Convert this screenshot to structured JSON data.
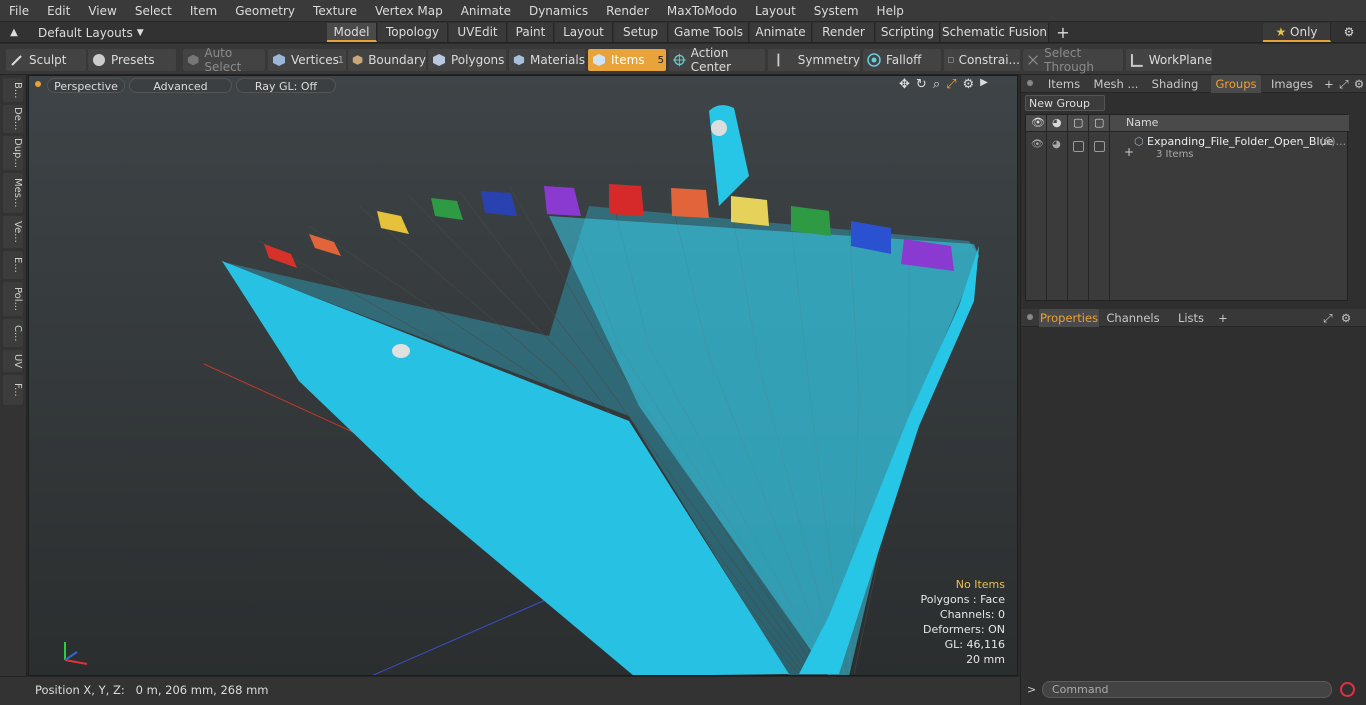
{
  "menu": [
    "File",
    "Edit",
    "View",
    "Select",
    "Item",
    "Geometry",
    "Texture",
    "Vertex Map",
    "Animate",
    "Dynamics",
    "Render",
    "MaxToModo",
    "Layout",
    "System",
    "Help"
  ],
  "layout_dropdown": "Default Layouts",
  "tabs": [
    "Model",
    "Topology",
    "UVEdit",
    "Paint",
    "Layout",
    "Setup",
    "Game Tools",
    "Animate",
    "Render",
    "Scripting",
    "Schematic Fusion"
  ],
  "only_label": "Only",
  "toolbar": {
    "sculpt": "Sculpt",
    "presets": "Presets",
    "auto_select": "Auto Select",
    "vertices": "Vertices",
    "vertices_count": "1",
    "boundary": "Boundary",
    "polygons": "Polygons",
    "materials": "Materials",
    "items": "Items",
    "items_count": "5",
    "action_center": "Action Center",
    "symmetry": "Symmetry",
    "falloff": "Falloff",
    "constraints": "Constrai...",
    "select_through": "Select Through",
    "workplane": "WorkPlane"
  },
  "left_tabs": [
    "B...",
    "De...",
    "Dup...",
    "Mes...",
    "Ve...",
    "E...",
    "Pol...",
    "C...",
    "UV",
    "F..."
  ],
  "viewport": {
    "perspective": "Perspective",
    "advanced": "Advanced",
    "raygl": "Ray GL: Off",
    "info": {
      "no_items": "No Items",
      "polygons": "Polygons : Face",
      "channels": "Channels: 0",
      "deformers": "Deformers: ON",
      "gl": "GL: 46,116",
      "scale": "20 mm"
    }
  },
  "status": "Position X, Y, Z:   0 m, 206 mm, 268 mm",
  "right_top_tabs": [
    "Items",
    "Mesh ...",
    "Shading",
    "Groups",
    "Images"
  ],
  "new_group": "New Group",
  "groups_table": {
    "name_header": "Name",
    "item_name": "Expanding_File_Folder_Open_Blue",
    "item_count": "(6)...",
    "item_sub": "3 Items"
  },
  "right_bottom_tabs": [
    "Properties",
    "Channels",
    "Lists"
  ],
  "command_placeholder": "Command",
  "colors": {
    "accent": "#e8a33a",
    "folder": "#27c6e6"
  }
}
